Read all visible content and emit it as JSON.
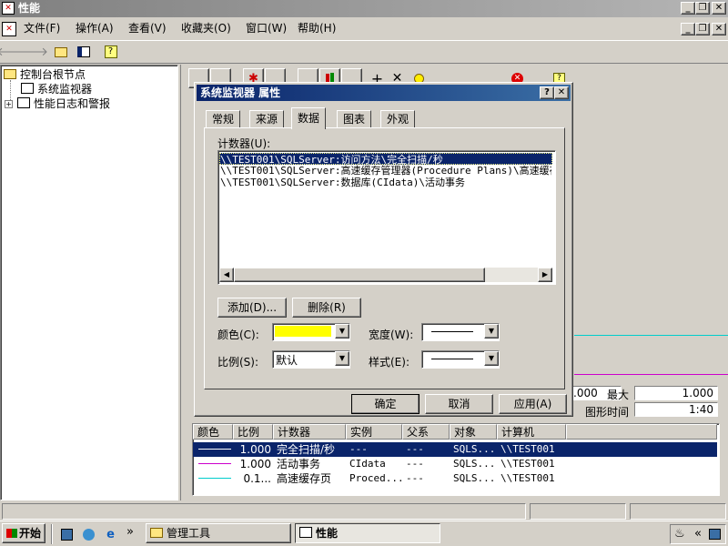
{
  "app": {
    "title": "性能",
    "menu": [
      "文件(F)",
      "操作(A)",
      "查看(V)",
      "收藏夹(O)",
      "窗口(W)",
      "帮助(H)"
    ]
  },
  "tree": {
    "root": "控制台根节点",
    "items": [
      "系统监视器",
      "性能日志和警报"
    ]
  },
  "dialog": {
    "title": "系统监视器 属性",
    "tabs": [
      "常规",
      "来源",
      "数据",
      "图表",
      "外观"
    ],
    "active_tab": "数据",
    "counters_label": "计数器(U):",
    "counters": [
      "\\\\TEST001\\SQLServer:访问方法\\完全扫描/秒",
      "\\\\TEST001\\SQLServer:高速缓存管理器(Procedure Plans)\\高速缓存",
      "\\\\TEST001\\SQLServer:数据库(CIdata)\\活动事务"
    ],
    "add_button": "添加(D)...",
    "remove_button": "删除(R)",
    "color_label": "颜色(C):",
    "color_value": "#ffff00",
    "width_label": "宽度(W):",
    "scale_label": "比例(S):",
    "scale_value": "默认",
    "style_label": "样式(E):",
    "ok": "确定",
    "cancel": "取消",
    "apply": "应用(A)"
  },
  "graph_stats": {
    "min_value": ".000",
    "max_label": "最大",
    "max_value": "1.000",
    "time_label": "图形时间",
    "time_value": "1:40"
  },
  "legend": {
    "headers": [
      "颜色",
      "比例",
      "计数器",
      "实例",
      "父系",
      "对象",
      "计算机"
    ],
    "rows": [
      {
        "color": "#ffffff",
        "scale": "1.000",
        "counter": "完全扫描/秒",
        "instance": "---",
        "parent": "---",
        "object": "SQLS...",
        "computer": "\\\\TEST001",
        "selected": true
      },
      {
        "color": "#cc00cc",
        "scale": "1.000",
        "counter": "活动事务",
        "instance": "CIdata",
        "parent": "---",
        "object": "SQLS...",
        "computer": "\\\\TEST001",
        "selected": false
      },
      {
        "color": "#00cccc",
        "scale": "0.1...",
        "counter": "高速缓存页",
        "instance": "Proced...",
        "parent": "---",
        "object": "SQLS...",
        "computer": "\\\\TEST001",
        "selected": false
      }
    ]
  },
  "taskbar": {
    "start": "开始",
    "chevron": "»",
    "tasks": [
      "管理工具",
      "性能"
    ],
    "tray_chevron": "«"
  }
}
